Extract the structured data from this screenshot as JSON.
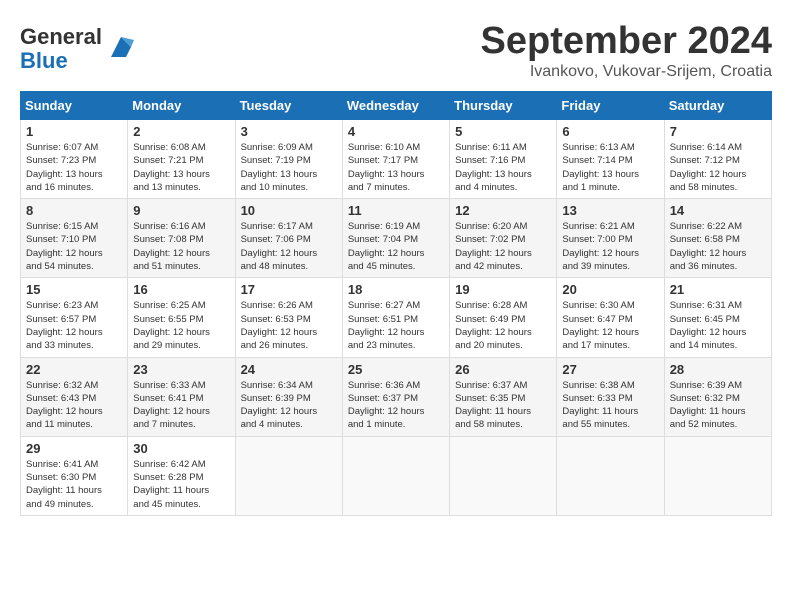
{
  "logo": {
    "general": "General",
    "blue": "Blue"
  },
  "title": "September 2024",
  "subtitle": "Ivankovo, Vukovar-Srijem, Croatia",
  "days_of_week": [
    "Sunday",
    "Monday",
    "Tuesday",
    "Wednesday",
    "Thursday",
    "Friday",
    "Saturday"
  ],
  "weeks": [
    [
      {
        "day": "1",
        "sunrise": "6:07 AM",
        "sunset": "7:23 PM",
        "daylight": "13 hours and 16 minutes."
      },
      {
        "day": "2",
        "sunrise": "6:08 AM",
        "sunset": "7:21 PM",
        "daylight": "13 hours and 13 minutes."
      },
      {
        "day": "3",
        "sunrise": "6:09 AM",
        "sunset": "7:19 PM",
        "daylight": "13 hours and 10 minutes."
      },
      {
        "day": "4",
        "sunrise": "6:10 AM",
        "sunset": "7:17 PM",
        "daylight": "13 hours and 7 minutes."
      },
      {
        "day": "5",
        "sunrise": "6:11 AM",
        "sunset": "7:16 PM",
        "daylight": "13 hours and 4 minutes."
      },
      {
        "day": "6",
        "sunrise": "6:13 AM",
        "sunset": "7:14 PM",
        "daylight": "13 hours and 1 minute."
      },
      {
        "day": "7",
        "sunrise": "6:14 AM",
        "sunset": "7:12 PM",
        "daylight": "12 hours and 58 minutes."
      }
    ],
    [
      {
        "day": "8",
        "sunrise": "6:15 AM",
        "sunset": "7:10 PM",
        "daylight": "12 hours and 54 minutes."
      },
      {
        "day": "9",
        "sunrise": "6:16 AM",
        "sunset": "7:08 PM",
        "daylight": "12 hours and 51 minutes."
      },
      {
        "day": "10",
        "sunrise": "6:17 AM",
        "sunset": "7:06 PM",
        "daylight": "12 hours and 48 minutes."
      },
      {
        "day": "11",
        "sunrise": "6:19 AM",
        "sunset": "7:04 PM",
        "daylight": "12 hours and 45 minutes."
      },
      {
        "day": "12",
        "sunrise": "6:20 AM",
        "sunset": "7:02 PM",
        "daylight": "12 hours and 42 minutes."
      },
      {
        "day": "13",
        "sunrise": "6:21 AM",
        "sunset": "7:00 PM",
        "daylight": "12 hours and 39 minutes."
      },
      {
        "day": "14",
        "sunrise": "6:22 AM",
        "sunset": "6:58 PM",
        "daylight": "12 hours and 36 minutes."
      }
    ],
    [
      {
        "day": "15",
        "sunrise": "6:23 AM",
        "sunset": "6:57 PM",
        "daylight": "12 hours and 33 minutes."
      },
      {
        "day": "16",
        "sunrise": "6:25 AM",
        "sunset": "6:55 PM",
        "daylight": "12 hours and 29 minutes."
      },
      {
        "day": "17",
        "sunrise": "6:26 AM",
        "sunset": "6:53 PM",
        "daylight": "12 hours and 26 minutes."
      },
      {
        "day": "18",
        "sunrise": "6:27 AM",
        "sunset": "6:51 PM",
        "daylight": "12 hours and 23 minutes."
      },
      {
        "day": "19",
        "sunrise": "6:28 AM",
        "sunset": "6:49 PM",
        "daylight": "12 hours and 20 minutes."
      },
      {
        "day": "20",
        "sunrise": "6:30 AM",
        "sunset": "6:47 PM",
        "daylight": "12 hours and 17 minutes."
      },
      {
        "day": "21",
        "sunrise": "6:31 AM",
        "sunset": "6:45 PM",
        "daylight": "12 hours and 14 minutes."
      }
    ],
    [
      {
        "day": "22",
        "sunrise": "6:32 AM",
        "sunset": "6:43 PM",
        "daylight": "12 hours and 11 minutes."
      },
      {
        "day": "23",
        "sunrise": "6:33 AM",
        "sunset": "6:41 PM",
        "daylight": "12 hours and 7 minutes."
      },
      {
        "day": "24",
        "sunrise": "6:34 AM",
        "sunset": "6:39 PM",
        "daylight": "12 hours and 4 minutes."
      },
      {
        "day": "25",
        "sunrise": "6:36 AM",
        "sunset": "6:37 PM",
        "daylight": "12 hours and 1 minute."
      },
      {
        "day": "26",
        "sunrise": "6:37 AM",
        "sunset": "6:35 PM",
        "daylight": "11 hours and 58 minutes."
      },
      {
        "day": "27",
        "sunrise": "6:38 AM",
        "sunset": "6:33 PM",
        "daylight": "11 hours and 55 minutes."
      },
      {
        "day": "28",
        "sunrise": "6:39 AM",
        "sunset": "6:32 PM",
        "daylight": "11 hours and 52 minutes."
      }
    ],
    [
      {
        "day": "29",
        "sunrise": "6:41 AM",
        "sunset": "6:30 PM",
        "daylight": "11 hours and 49 minutes."
      },
      {
        "day": "30",
        "sunrise": "6:42 AM",
        "sunset": "6:28 PM",
        "daylight": "11 hours and 45 minutes."
      },
      null,
      null,
      null,
      null,
      null
    ]
  ],
  "labels": {
    "sunrise": "Sunrise:",
    "sunset": "Sunset:",
    "daylight": "Daylight:"
  }
}
